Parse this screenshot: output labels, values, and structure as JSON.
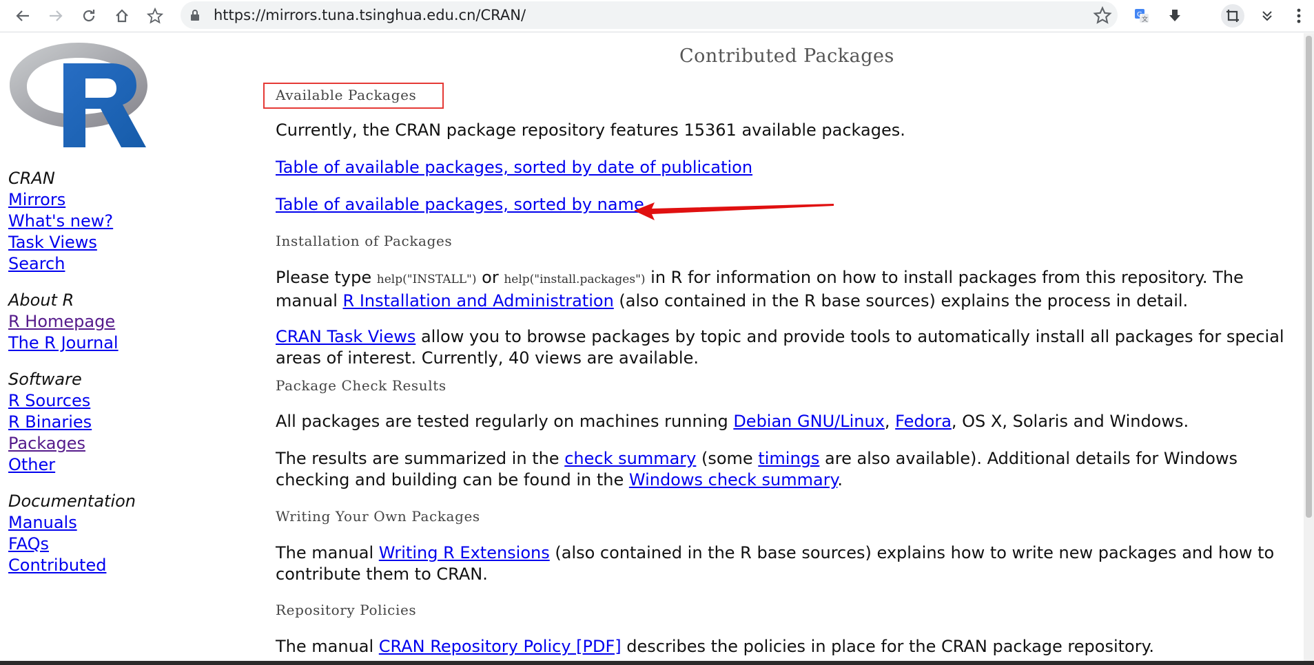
{
  "browser": {
    "url": "https://mirrors.tuna.tsinghua.edu.cn/CRAN/"
  },
  "sidebar": {
    "logo_alt": "R",
    "groups": [
      {
        "heading": "CRAN",
        "links": [
          "Mirrors",
          "What's new?",
          "Task Views",
          "Search"
        ]
      },
      {
        "heading": "About R",
        "links": [
          "R Homepage",
          "The R Journal"
        ]
      },
      {
        "heading": "Software",
        "links": [
          "R Sources",
          "R Binaries",
          "Packages",
          "Other"
        ]
      },
      {
        "heading": "Documentation",
        "links": [
          "Manuals",
          "FAQs",
          "Contributed"
        ]
      }
    ]
  },
  "main": {
    "title": "Contributed Packages",
    "sections": {
      "available": "Available Packages",
      "installation": "Installation of Packages",
      "check": "Package Check Results",
      "writing": "Writing Your Own Packages",
      "policies": "Repository Policies"
    },
    "available_text": "Currently, the CRAN package repository features 15361 available packages.",
    "link_by_date": "Table of available packages, sorted by date of publication",
    "link_by_name": "Table of available packages, sorted by name",
    "install": {
      "t1": "Please type ",
      "code1": "help(\"INSTALL\")",
      "t2": " or ",
      "code2": "help(\"install.packages\")",
      "t3": " in R for information on how to install packages from this repository. The manual ",
      "link": "R Installation and Administration",
      "t4": " (also contained in the R base sources) explains the process in detail."
    },
    "taskviews": {
      "link": "CRAN Task Views",
      "t1": " allow you to browse packages by topic and provide tools to automatically install all packages for special areas of interest. Currently, 40 views are available."
    },
    "check1": {
      "t1": "All packages are tested regularly on machines running ",
      "link1": "Debian GNU/Linux",
      "t2": ", ",
      "link2": "Fedora",
      "t3": ", OS X, Solaris and Windows."
    },
    "check2": {
      "t1": "The results are summarized in the ",
      "link1": "check summary",
      "t2": " (some ",
      "link2": "timings",
      "t3": " are also available). Additional details for Windows checking and building can be found in the ",
      "link3": "Windows check summary",
      "t4": "."
    },
    "writing": {
      "t1": "The manual ",
      "link": "Writing R Extensions",
      "t2": " (also contained in the R base sources) explains how to write new packages and how to contribute them to CRAN."
    },
    "policy": {
      "t1": "The manual ",
      "link": "CRAN Repository Policy [PDF]",
      "t2": " describes the policies in place for the CRAN package repository."
    }
  },
  "colors": {
    "link": "#0000ee",
    "visited": "#551a8b",
    "annotation": "#e53935"
  }
}
